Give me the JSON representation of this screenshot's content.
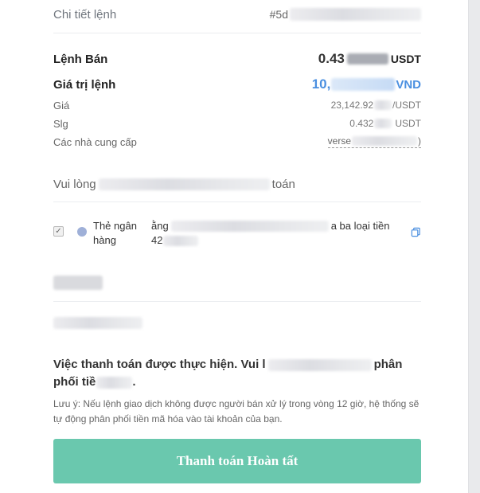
{
  "header": {
    "title": "Chi tiết lệnh",
    "order_id_prefix": "#5d"
  },
  "order": {
    "side_label": "Lệnh Bán",
    "amount_prefix": "0.43",
    "amount_unit": "USDT",
    "value_label": "Giá trị lệnh",
    "value_prefix": "10,",
    "value_unit": "VND",
    "price_label": "Giá",
    "price_prefix": "23,142.92",
    "price_suffix": "/USDT",
    "qty_label": "Slg",
    "qty_prefix": "0.432",
    "qty_unit": "USDT",
    "provider_label": "Các nhà cung cấp",
    "provider_prefix": "verse",
    "provider_suffix": ")"
  },
  "payment": {
    "instruction_prefix": "Vui lòng",
    "instruction_suffix": "toán",
    "method_label": "Thẻ ngân hàng",
    "method_desc_prefix": "ằng",
    "method_desc_suffix": "a ba loại tiền",
    "method_desc_line2": "42"
  },
  "notice": {
    "bold_prefix": "Việc thanh toán được thực hiện. Vui l",
    "bold_middle": "phân",
    "bold_line2": "phối tiề",
    "bold_end": ".",
    "note": "Lưu ý: Nếu lệnh giao dịch không được người bán xử lý trong vòng 12 giờ, hệ thống sẽ tự động phân phối tiền mã hóa vào tài khoản của bạn."
  },
  "actions": {
    "complete_label": "Thanh toán Hoàn tất"
  },
  "colors": {
    "accent_button": "#6ac8ae",
    "value_blue": "#4a8fe0"
  },
  "icons": {
    "copy": "copy-icon",
    "checkbox": "checkbox-checked"
  }
}
